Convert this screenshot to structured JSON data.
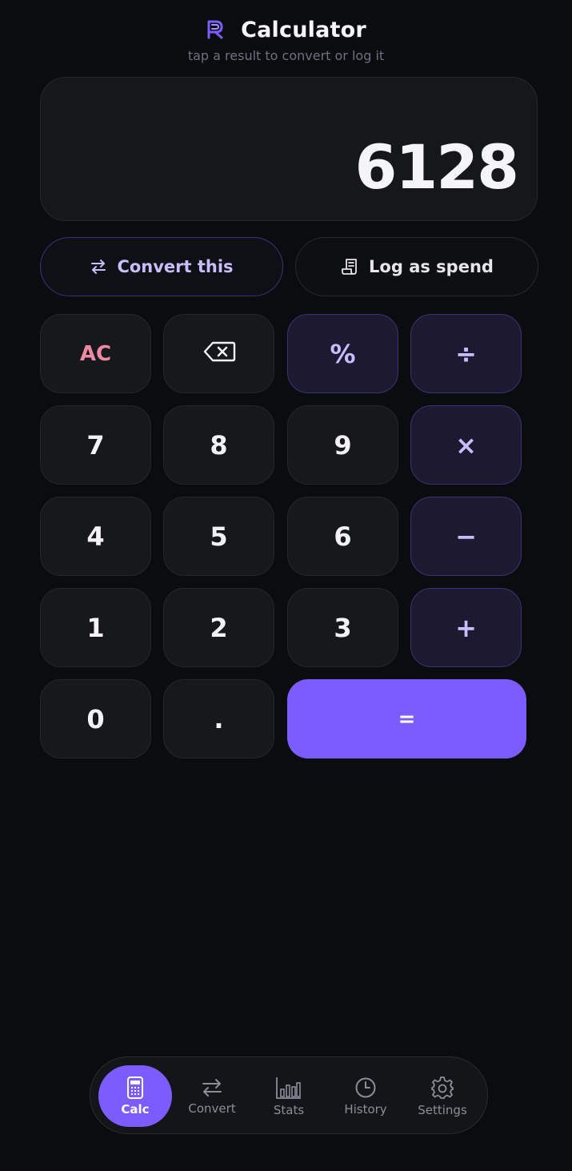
{
  "header": {
    "title": "Calculator",
    "subtitle": "tap a result to convert or log it",
    "logo_icon": "r-logo-icon"
  },
  "display": {
    "value": "6128"
  },
  "actions": {
    "convert_label": "Convert this",
    "convert_icon": "swap-arrows-icon",
    "log_label": "Log as spend",
    "log_icon": "receipt-icon"
  },
  "keypad": {
    "clear": "AC",
    "backspace": "⌫",
    "percent": "%",
    "divide": "÷",
    "seven": "7",
    "eight": "8",
    "nine": "9",
    "multiply": "×",
    "four": "4",
    "five": "5",
    "six": "6",
    "minus": "−",
    "one": "1",
    "two": "2",
    "three": "3",
    "plus": "+",
    "zero": "0",
    "decimal": ".",
    "equals": "="
  },
  "tabs": [
    {
      "label": "Calc",
      "icon": "calculator-icon",
      "active": true
    },
    {
      "label": "Convert",
      "icon": "swap-arrows-icon",
      "active": false
    },
    {
      "label": "Stats",
      "icon": "bar-chart-icon",
      "active": false
    },
    {
      "label": "History",
      "icon": "clock-icon",
      "active": false
    },
    {
      "label": "Settings",
      "icon": "gear-icon",
      "active": false
    }
  ],
  "colors": {
    "accent": "#7c5cff",
    "background": "#0b0c0f",
    "key_bg": "#17181c",
    "operator_bg": "#1d1930",
    "operator_text": "#c8bcff",
    "clear_text": "#f08aa3"
  }
}
